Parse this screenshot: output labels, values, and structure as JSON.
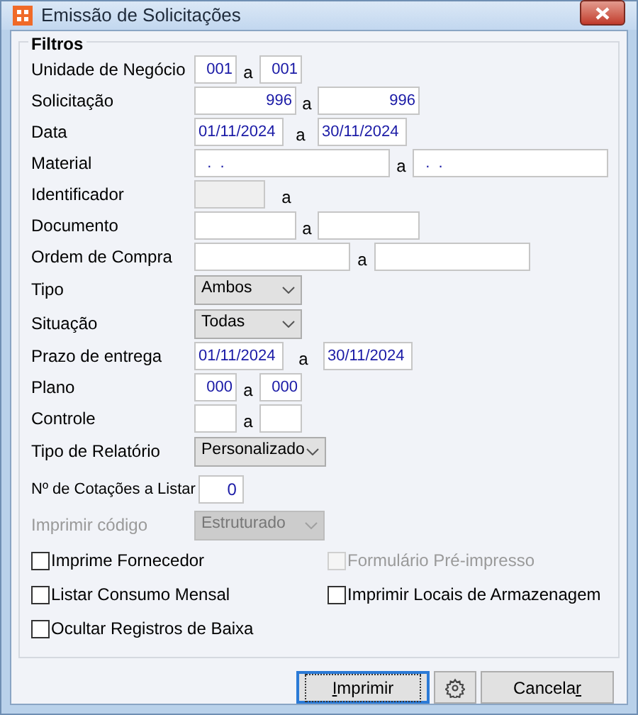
{
  "window": {
    "title": "Emissão de Solicitações"
  },
  "group": {
    "title": "Filtros"
  },
  "fields": [
    {
      "kind": "range",
      "label": "Unidade de Negócio",
      "from": {
        "value": "001",
        "disabled": false
      },
      "to": {
        "value": "001",
        "disabled": false
      },
      "sep": "a"
    },
    {
      "kind": "range",
      "label": "Solicitação",
      "from": {
        "value": "996",
        "disabled": false
      },
      "to": {
        "value": "996",
        "disabled": false
      },
      "sep": "a"
    },
    {
      "kind": "range",
      "label": "Data",
      "from": {
        "value": "01/11/2024",
        "disabled": false
      },
      "to": {
        "value": "30/11/2024",
        "disabled": false
      },
      "sep": "a"
    },
    {
      "kind": "range",
      "label": "Material",
      "from": {
        "value": "  .  .",
        "disabled": false
      },
      "to": {
        "value": "  .  .",
        "disabled": false
      },
      "sep": "a"
    },
    {
      "kind": "range",
      "label": "Identificador",
      "from": {
        "disabled": true
      },
      "sep": "a"
    },
    {
      "kind": "range",
      "label": "Documento",
      "from": {
        "disabled": false
      },
      "to": {
        "disabled": false
      },
      "sep": "a"
    },
    {
      "kind": "range",
      "label": "Ordem de Compra",
      "from": {
        "disabled": false
      },
      "to": {
        "disabled": false
      },
      "sep": "a"
    },
    {
      "kind": "select",
      "label": "Tipo",
      "value": "Ambos",
      "disabled": false
    },
    {
      "kind": "select",
      "label": "Situação",
      "value": "Todas",
      "disabled": false
    },
    {
      "kind": "range",
      "label": "Prazo de entrega",
      "from": {
        "value": "01/11/2024",
        "disabled": false
      },
      "to": {
        "value": "30/11/2024",
        "disabled": false
      },
      "sep": "a"
    },
    {
      "kind": "range",
      "label": "Plano",
      "from": {
        "value": "000",
        "disabled": false
      },
      "to": {
        "value": "000",
        "disabled": false
      },
      "sep": "a"
    },
    {
      "kind": "range",
      "label": "Controle",
      "from": {
        "disabled": false
      },
      "to": {
        "disabled": false
      },
      "sep": "a"
    },
    {
      "kind": "select",
      "label": "Tipo de Relatório",
      "value": "Personalizado",
      "disabled": false
    },
    {
      "kind": "number",
      "label": "Nº de Cotações a Listar",
      "value": "0"
    },
    {
      "kind": "select",
      "label": "Imprimir código",
      "value": "Estruturado",
      "disabled": true
    }
  ],
  "checkboxes": [
    {
      "label": "Imprime Fornecedor",
      "checked": false,
      "disabled": false
    },
    {
      "label": "Formulário Pré-impresso",
      "checked": false,
      "disabled": true
    },
    {
      "label": "Listar Consumo Mensal",
      "checked": false,
      "disabled": false
    },
    {
      "label": "Imprimir Locais de Armazenagem",
      "checked": false,
      "disabled": false
    },
    {
      "label": "Ocultar Registros de Baixa",
      "checked": false,
      "disabled": false
    }
  ],
  "buttons": [
    {
      "kind": "text",
      "key": "I",
      "post": "mprimir",
      "default": true
    },
    {
      "kind": "gear",
      "default": false
    },
    {
      "kind": "text",
      "pre": "Cancela",
      "key": "r",
      "default": false
    }
  ]
}
